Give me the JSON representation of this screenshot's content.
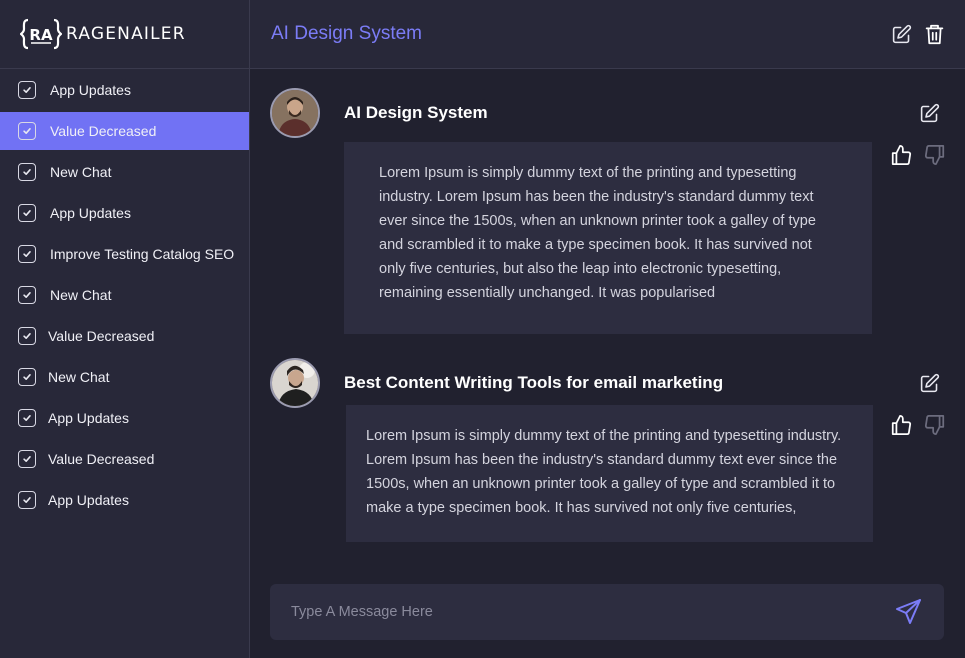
{
  "brand": {
    "mark": "{RA}",
    "name": "RAGENAILER"
  },
  "sidebar": {
    "items": [
      {
        "label": "App Updates",
        "active": false
      },
      {
        "label": "Value Decreased",
        "active": true
      },
      {
        "label": "New Chat",
        "active": false
      },
      {
        "label": "App Updates",
        "active": false
      },
      {
        "label": "Improve Testing Catalog SEO",
        "active": false
      },
      {
        "label": "New Chat",
        "active": false
      },
      {
        "label": "Value Decreased",
        "active": false
      },
      {
        "label": "New Chat",
        "active": false
      },
      {
        "label": "App Updates",
        "active": false
      },
      {
        "label": "Value Decreased",
        "active": false
      },
      {
        "label": "App Updates",
        "active": false
      }
    ]
  },
  "header": {
    "title": "AI Design System"
  },
  "messages": [
    {
      "title": "AI  Design System",
      "body": "Lorem Ipsum is simply dummy text of the printing and typesetting industry. Lorem Ipsum has been the industry's standard dummy text ever since the 1500s, when an unknown printer took a galley of type and scrambled it to make a type specimen book. It has survived not only five centuries, but also the leap into electronic typesetting, remaining essentially unchanged. It was popularised"
    },
    {
      "title": "Best Content Writing Tools for email marketing",
      "body": "Lorem Ipsum is simply dummy text of the printing and typesetting industry. Lorem Ipsum has been the industry's standard dummy text ever since the 1500s, when an unknown printer took a galley of type and scrambled it to make a type specimen book. It has survived not only five centuries,"
    }
  ],
  "composer": {
    "placeholder": "Type A Message Here"
  },
  "colors": {
    "accent": "#7172f4",
    "sidebar_bg": "#282839",
    "main_bg": "#21212f",
    "card_bg": "#2d2d40"
  },
  "icons": {
    "edit": "edit-icon",
    "delete": "trash-icon",
    "like": "thumbs-up-icon",
    "dislike": "thumbs-down-icon",
    "send": "send-icon",
    "check": "checkbox-icon"
  }
}
